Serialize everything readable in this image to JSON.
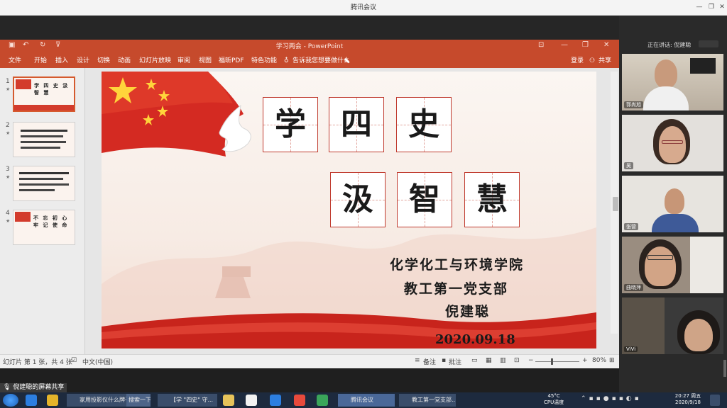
{
  "meeting": {
    "title": "腾讯会议",
    "speaking_label": "正在讲话: 倪建聪",
    "share_label": "倪建聪的屏幕共享",
    "participants": [
      "郭尚旭",
      "吴",
      "张营",
      "曲晓萍",
      "ViVi"
    ]
  },
  "ppt": {
    "window_title": "学习两会 - PowerPoint",
    "menu": [
      "文件",
      "开始",
      "插入",
      "设计",
      "切换",
      "动画",
      "幻灯片放映",
      "审阅",
      "视图",
      "福昕PDF",
      "特色功能"
    ],
    "tell_me": "告诉我您想要做什么",
    "login": "登录",
    "share": "共享",
    "thumbnails": [
      {
        "num": "1",
        "text": "学 四 史 汲 智 慧"
      },
      {
        "num": "2",
        "text": ""
      },
      {
        "num": "3",
        "text": ""
      },
      {
        "num": "4",
        "text": "不 忘 初 心 牢 记 使 命"
      }
    ],
    "status": {
      "slide_info": "幻灯片 第 1 张，共 4 张",
      "language": "中文(中国)",
      "notes": "备注",
      "comments": "批注",
      "zoom": "80%"
    }
  },
  "slide": {
    "row1": [
      "学",
      "四",
      "史"
    ],
    "row2": [
      "汲",
      "智",
      "慧"
    ],
    "org1": "化学化工与环境学院",
    "org2": "教工第一党支部",
    "author": "倪建聪",
    "date": "2020.09.18"
  },
  "taskbar": {
    "items": [
      "家用投影仪什么牌子好",
      "搜索一下",
      "【学 \"四史\" 守...",
      "腾讯会议",
      "教工第一党支部..."
    ],
    "temp": "45°C",
    "temp_label": "CPU温度",
    "time": "20:27 周五",
    "date": "2020/9/18"
  },
  "colors": {
    "ppt_red": "#c64a2c",
    "slide_red": "#c03a2e",
    "taskbar": "#1d2a3e"
  }
}
